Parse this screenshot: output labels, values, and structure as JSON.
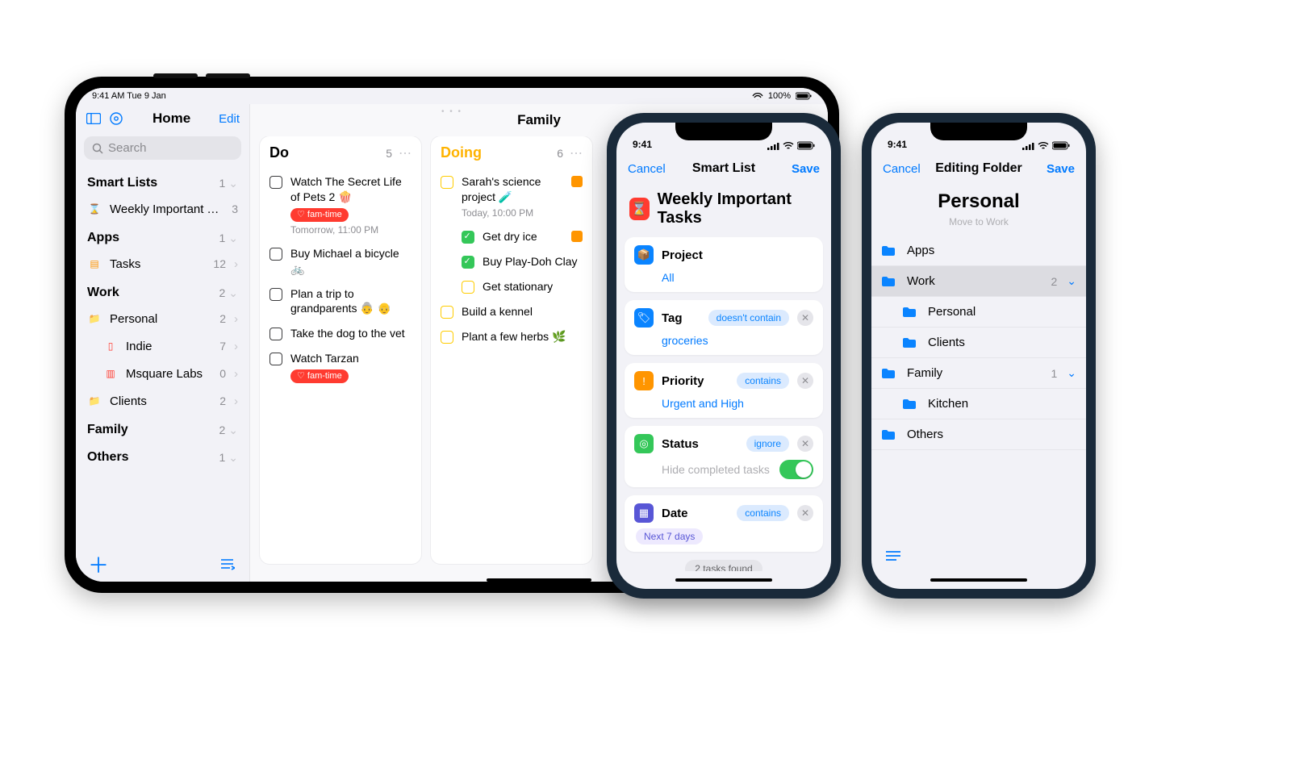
{
  "ipad": {
    "status_time": "9:41 AM  Tue 9 Jan",
    "status_right": "100%",
    "sidebar": {
      "title": "Home",
      "edit": "Edit",
      "search_placeholder": "Search",
      "sections": [
        {
          "name": "Smart Lists",
          "count": "1",
          "items": [
            {
              "icon": "⌛",
              "iconColor": "#ff3b30",
              "label": "Weekly Important Tasks",
              "count": "3"
            }
          ]
        },
        {
          "name": "Apps",
          "count": "1",
          "items": [
            {
              "icon": "▤",
              "iconColor": "#ff9500",
              "label": "Tasks",
              "count": "12",
              "chev": true
            }
          ]
        },
        {
          "name": "Work",
          "count": "2",
          "items": [
            {
              "icon": "📁",
              "iconColor": "#0a84ff",
              "label": "Personal",
              "count": "2",
              "chev": true,
              "indent": 0
            },
            {
              "icon": "▯",
              "iconColor": "#ff3b30",
              "label": "Indie",
              "count": "7",
              "chev": true,
              "indent": 1
            },
            {
              "icon": "▥",
              "iconColor": "#ff3b30",
              "label": "Msquare Labs",
              "count": "0",
              "chev": true,
              "indent": 1
            },
            {
              "icon": "📁",
              "iconColor": "#0a84ff",
              "label": "Clients",
              "count": "2",
              "chev": true,
              "indent": 0
            }
          ]
        },
        {
          "name": "Family",
          "count": "2",
          "items": []
        },
        {
          "name": "Others",
          "count": "1",
          "items": []
        }
      ]
    },
    "board_title": "Family",
    "columns": [
      {
        "name": "Do",
        "color": "#000",
        "count": "5",
        "tasks": [
          {
            "cb": "empty",
            "text": "Watch The Secret Life of Pets 2 🍿",
            "chip": "fam-time",
            "sub": "Tomorrow, 11:00 PM"
          },
          {
            "cb": "empty",
            "text": "Buy Michael a bicycle 🚲"
          },
          {
            "cb": "empty",
            "text": "Plan a trip to grandparents 👵 👴"
          },
          {
            "cb": "empty",
            "text": "Take the dog to the vet"
          },
          {
            "cb": "empty",
            "text": "Watch Tarzan",
            "chip": "fam-time"
          }
        ]
      },
      {
        "name": "Doing",
        "color": "#ffb300",
        "count": "6",
        "tasks": [
          {
            "cb": "yellow",
            "text": "Sarah's science project 🧪",
            "sub": "Today, 10:00 PM",
            "flag": true,
            "subtasks": [
              {
                "cb": "done",
                "text": "Get dry ice",
                "flag": true
              },
              {
                "cb": "done",
                "text": "Buy Play-Doh Clay"
              },
              {
                "cb": "yellow",
                "text": "Get stationary"
              }
            ]
          },
          {
            "cb": "yellow",
            "text": "Build a kennel"
          },
          {
            "cb": "yellow",
            "text": "Plant a few herbs 🌿"
          }
        ]
      }
    ]
  },
  "phone1": {
    "time": "9:41",
    "nav": {
      "left": "Cancel",
      "title": "Smart List",
      "right": "Save"
    },
    "list_title": "Weekly Important Tasks",
    "filters": [
      {
        "icon_bg": "#0a84ff",
        "icon": "📦",
        "name": "Project",
        "value": "All"
      },
      {
        "icon_bg": "#0a84ff",
        "icon": "🏷",
        "name": "Tag",
        "pill": "doesn't contain",
        "value": "groceries",
        "x": true
      },
      {
        "icon_bg": "#ff9500",
        "icon": "!",
        "name": "Priority",
        "pill": "contains",
        "value": "Urgent and High",
        "x": true
      },
      {
        "icon_bg": "#34c759",
        "icon": "◎",
        "name": "Status",
        "pill": "ignore",
        "value": "Hide completed tasks",
        "x": true,
        "toggle": true,
        "valueGrey": true
      },
      {
        "icon_bg": "#5856d6",
        "icon": "▦",
        "name": "Date",
        "pill": "contains",
        "value_pill": "Next 7 days",
        "x": true
      }
    ],
    "result": "2 tasks found"
  },
  "phone2": {
    "time": "9:41",
    "nav": {
      "left": "Cancel",
      "title": "Editing Folder",
      "right": "Save"
    },
    "folder_name": "Personal",
    "move_hint": "Move to Work",
    "rows": [
      {
        "label": "Apps",
        "indent": 0
      },
      {
        "label": "Work",
        "indent": 0,
        "selected": true,
        "count": "2",
        "chev": true
      },
      {
        "label": "Personal",
        "indent": 1
      },
      {
        "label": "Clients",
        "indent": 1
      },
      {
        "label": "Family",
        "indent": 0,
        "count": "1",
        "chev": true
      },
      {
        "label": "Kitchen",
        "indent": 1
      },
      {
        "label": "Others",
        "indent": 0
      }
    ]
  }
}
